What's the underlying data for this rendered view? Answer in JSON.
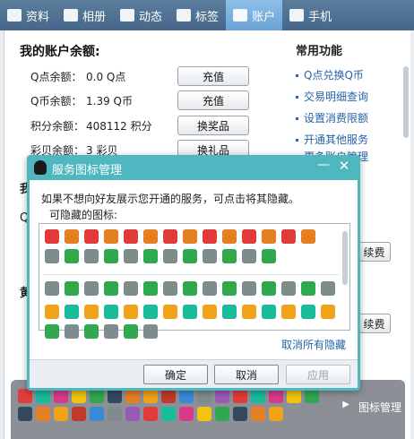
{
  "tabs": [
    {
      "label": "资料",
      "icon": "profile-icon",
      "active": false
    },
    {
      "label": "相册",
      "icon": "photo-icon",
      "active": false
    },
    {
      "label": "动态",
      "icon": "feed-icon",
      "active": false
    },
    {
      "label": "标签",
      "icon": "bookmark-icon",
      "active": false
    },
    {
      "label": "账户",
      "icon": "wallet-icon",
      "active": true
    },
    {
      "label": "手机",
      "icon": "phone-icon",
      "active": false
    }
  ],
  "account": {
    "title": "我的账户余额:",
    "rows": [
      {
        "label": "Q点余额：",
        "value": "0.0 Q点",
        "button": "充值"
      },
      {
        "label": "Q币余额：",
        "value": "1.39 Q币",
        "button": "充值"
      },
      {
        "label": "积分余额：",
        "value": "408112 积分",
        "button": "换奖品"
      },
      {
        "label": "彩贝余额：",
        "value": "3 彩贝",
        "button": "换礼品"
      }
    ]
  },
  "common": {
    "title": "常用功能",
    "links": [
      "Q点兑换Q币",
      "交易明细查询",
      "设置消费限额",
      "开通其他服务",
      "更多账户管理"
    ]
  },
  "renew_buttons": [
    "续费",
    "续费"
  ],
  "bottom_bar": {
    "label": "图标管理"
  },
  "dialog": {
    "title": "服务图标管理",
    "description": "如果不想向好友展示您开通的服务，可点击将其隐藏。",
    "subtitle": "可隐藏的图标:",
    "cancel_all": "取消所有隐藏",
    "ok": "确定",
    "cancel": "取消",
    "apply": "应用"
  },
  "colors": {
    "accent": "#4fb7bf",
    "link": "#2563a8",
    "tab_active": "#6aa3d4",
    "tab_bar": "#46678a"
  }
}
